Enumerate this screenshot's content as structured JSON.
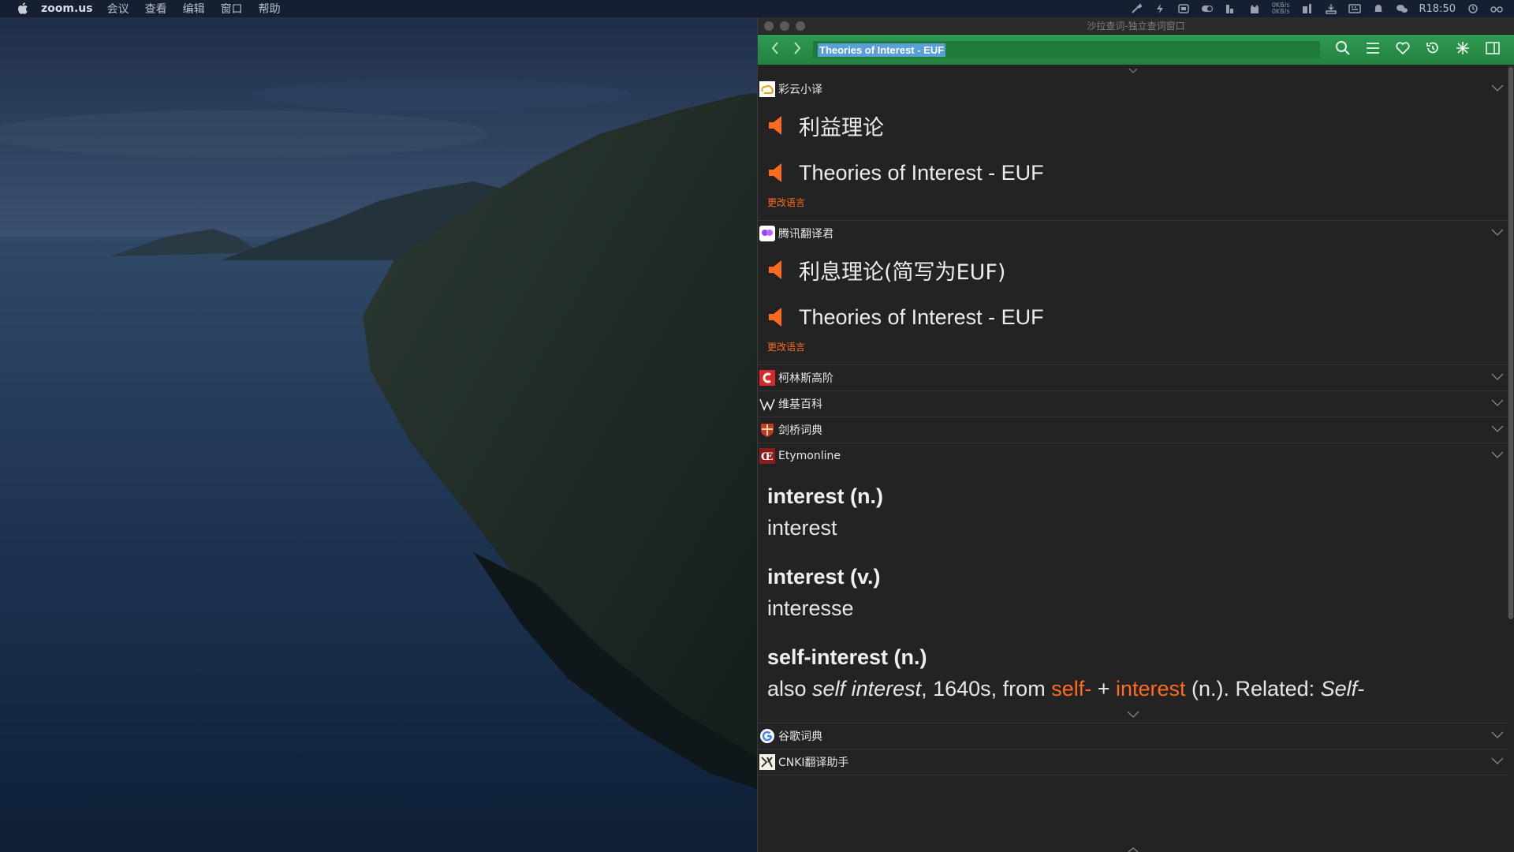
{
  "menubar": {
    "app_name": "zoom.us",
    "menus": [
      "会议",
      "查看",
      "编辑",
      "窗口",
      "帮助"
    ],
    "net_speed_up": "0KB/s",
    "net_speed_down": "0KB/s",
    "clock": "R18:50"
  },
  "window": {
    "title": "沙拉查词-独立查词窗口",
    "search_value": "Theories of Interest - EUF"
  },
  "sections": {
    "caiyun": {
      "name": "彩云小译",
      "translation": "利益理论",
      "source": "Theories of Interest - EUF",
      "change_lang": "更改语言"
    },
    "tencent": {
      "name": "腾讯翻译君",
      "translation": "利息理论(简写为EUF)",
      "source": "Theories of Interest - EUF",
      "change_lang": "更改语言"
    },
    "collins": {
      "name": "柯林斯高阶"
    },
    "wikipedia": {
      "name": "维基百科"
    },
    "cambridge": {
      "name": "剑桥词典"
    },
    "etymonline": {
      "name": "Etymonline",
      "entries": [
        {
          "head": "interest (n.)",
          "def": "interest"
        },
        {
          "head": "interest (v.)",
          "def": "interesse"
        },
        {
          "head": "self-interest (n.)"
        }
      ],
      "self_interest_def": {
        "p1": "also ",
        "p2": "self interest",
        "p3": ", 1640s, from ",
        "link1": "self-",
        "p4": " + ",
        "link2": "interest",
        "p5": " (n.). Related: ",
        "p6": "Self-"
      }
    },
    "google": {
      "name": "谷歌词典"
    },
    "cnki": {
      "name": "CNKI翻译助手"
    }
  },
  "colors": {
    "toolbar_green": "#2f9a54",
    "accent_orange": "#ff6a1f",
    "panel_bg": "#232323"
  },
  "icons": [
    "apple-icon",
    "back-icon",
    "forward-icon",
    "search-icon",
    "menu-icon",
    "heart-icon",
    "history-icon",
    "pin-icon",
    "sidebar-icon",
    "speaker-icon",
    "chevron-down-icon"
  ]
}
